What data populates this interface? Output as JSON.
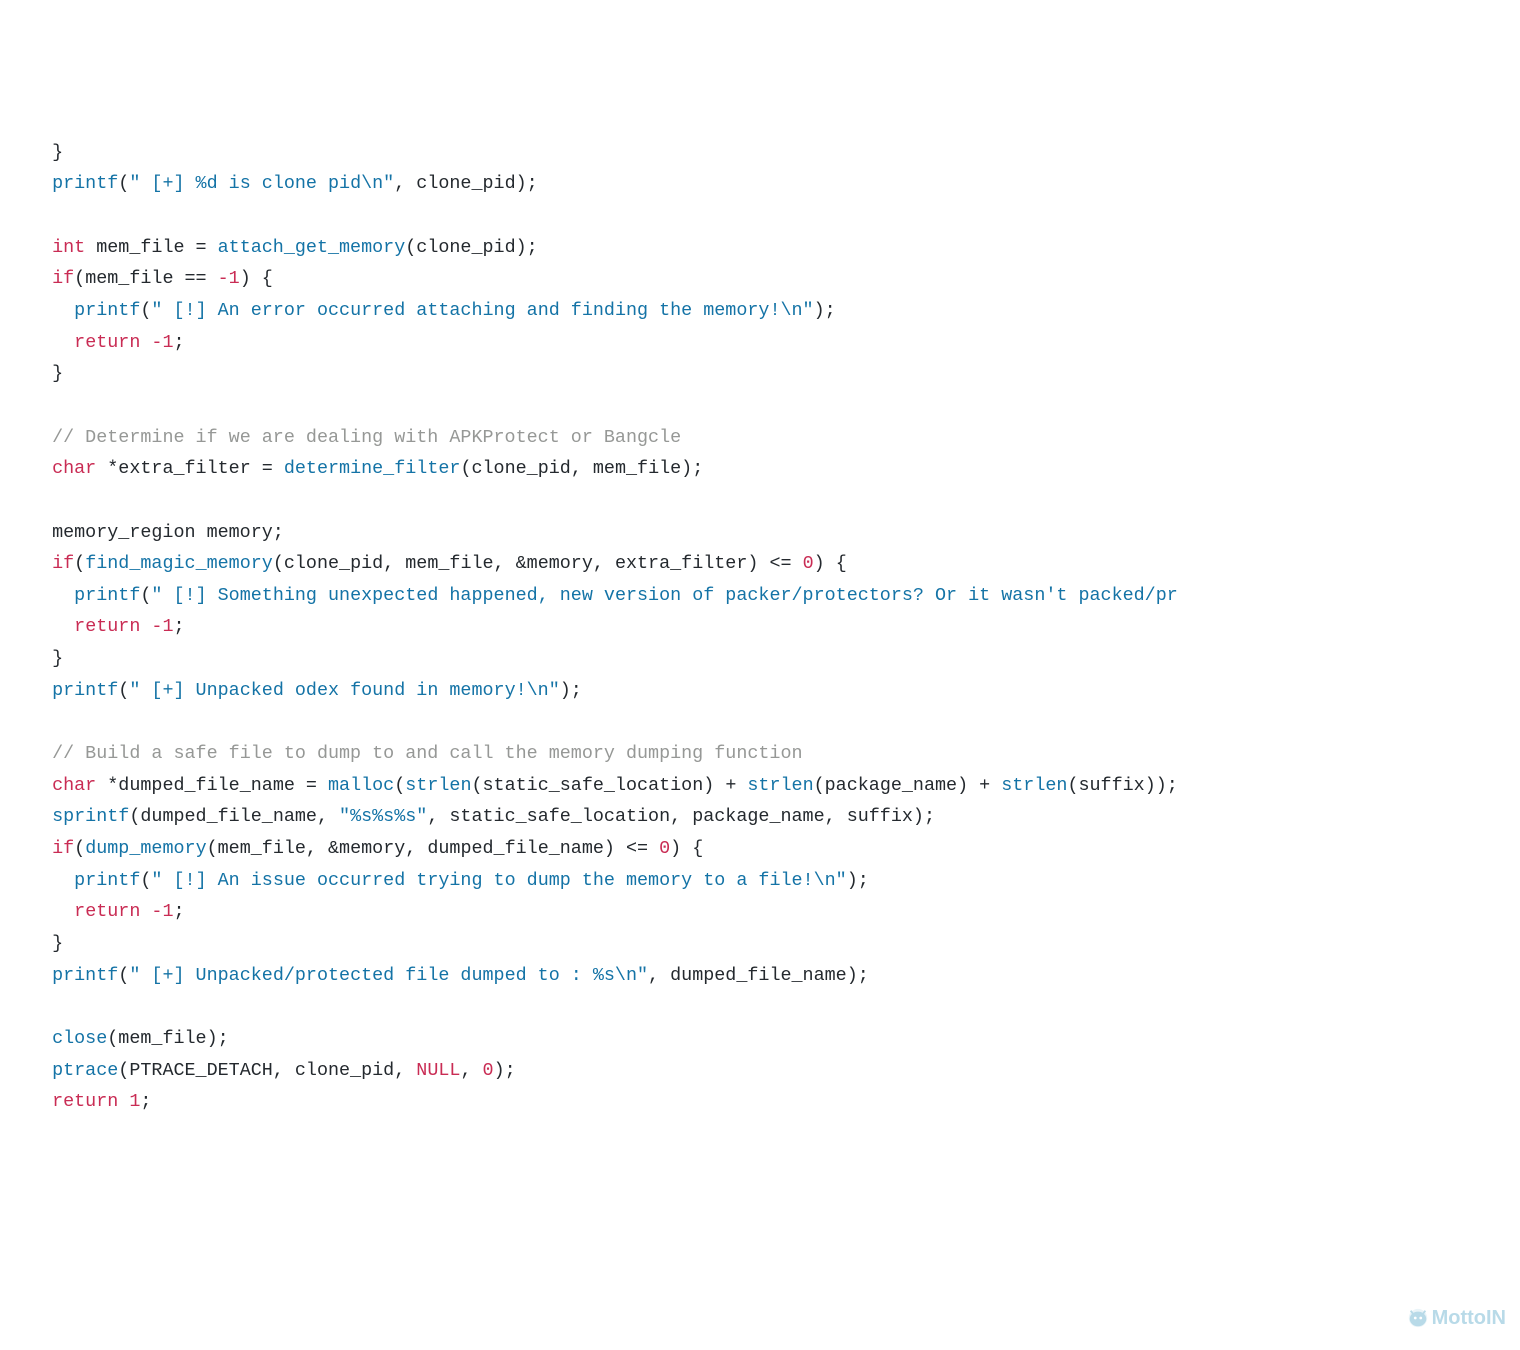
{
  "code": {
    "l1_brace": "  }",
    "l2_fn": "printf",
    "l2_str": "\" [+] %d is clone pid\\n\"",
    "l2_rest": ", clone_pid);",
    "l4_kw": "int",
    "l4_var": " mem_file = ",
    "l4_fn": "attach_get_memory",
    "l4_rest": "(clone_pid);",
    "l5_kw": "if",
    "l5_cond": "(mem_file == ",
    "l5_neg": "-1",
    "l5_rest": ") {",
    "l6_fn": "printf",
    "l6_str": "\" [!] An error occurred attaching and finding the memory!\\n\"",
    "l6_rest": ");",
    "l7_kw": "return",
    "l7_val": " -1",
    "l7_semi": ";",
    "l8_brace": "  }",
    "l10_cmt": "// Determine if we are dealing with APKProtect or Bangcle",
    "l11_kw": "char",
    "l11_var": " *extra_filter = ",
    "l11_fn": "determine_filter",
    "l11_rest": "(clone_pid, mem_file);",
    "l13_txt": "  memory_region memory;",
    "l14_kw": "if",
    "l14_p1": "(",
    "l14_fn": "find_magic_memory",
    "l14_args": "(clone_pid, mem_file, &memory, extra_filter) <= ",
    "l14_zero": "0",
    "l14_rest": ") {",
    "l15_fn": "printf",
    "l15_str": "\" [!] Something unexpected happened, new version of packer/protectors? Or it wasn't packed/pr",
    "l16_kw": "return",
    "l16_val": " -1",
    "l16_semi": ";",
    "l17_brace": "  }",
    "l18_fn": "printf",
    "l18_str": "\" [+] Unpacked odex found in memory!\\n\"",
    "l18_rest": ");",
    "l20_cmt": "// Build a safe file to dump to and call the memory dumping function",
    "l21_kw": "char",
    "l21_var": " *dumped_file_name = ",
    "l21_fn1": "malloc",
    "l21_p1": "(",
    "l21_fn2": "strlen",
    "l21_a1": "(static_safe_location) + ",
    "l21_fn3": "strlen",
    "l21_a2": "(package_name) + ",
    "l21_fn4": "strlen",
    "l21_a3": "(suffix));",
    "l22_fn": "sprintf",
    "l22_p1": "(dumped_file_name, ",
    "l22_str": "\"%s%s%s\"",
    "l22_rest": ", static_safe_location, package_name, suffix);",
    "l23_kw": "if",
    "l23_p1": "(",
    "l23_fn": "dump_memory",
    "l23_args": "(mem_file, &memory, dumped_file_name) <= ",
    "l23_zero": "0",
    "l23_rest": ") {",
    "l24_fn": "printf",
    "l24_str": "\" [!] An issue occurred trying to dump the memory to a file!\\n\"",
    "l24_rest": ");",
    "l25_kw": "return",
    "l25_val": " -1",
    "l25_semi": ";",
    "l26_brace": "  }",
    "l27_fn": "printf",
    "l27_str": "\" [+] Unpacked/protected file dumped to : %s\\n\"",
    "l27_rest": ", dumped_file_name);",
    "l29_fn": "close",
    "l29_rest": "(mem_file);",
    "l30_fn": "ptrace",
    "l30_p1": "(PTRACE_DETACH, clone_pid, ",
    "l30_null": "NULL",
    "l30_c2": ", ",
    "l30_zero": "0",
    "l30_rest": ");",
    "l31_kw": "return",
    "l31_val": " 1",
    "l31_semi": ";"
  },
  "watermark": "MottoIN"
}
